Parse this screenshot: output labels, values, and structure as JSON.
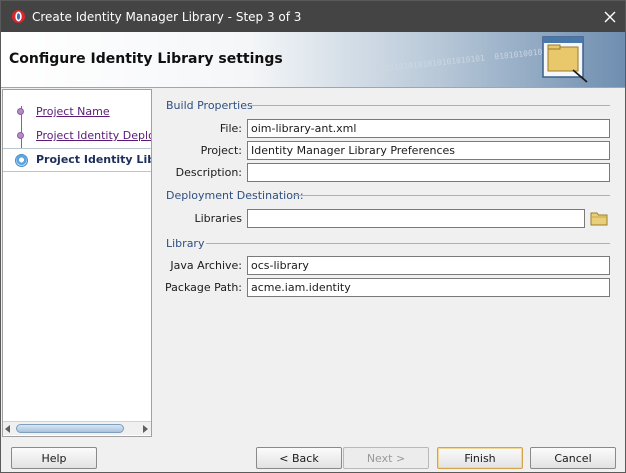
{
  "window": {
    "title": "Create Identity Manager Library - Step 3 of 3"
  },
  "header": {
    "title": "Configure Identity Library settings",
    "binary_watermark": "0101010101010101010101  0101010010"
  },
  "nav": {
    "items": [
      {
        "label": "Project Name",
        "state": "visited"
      },
      {
        "label": "Project Identity Deployment",
        "state": "visited"
      },
      {
        "label": "Project Identity Library",
        "state": "current"
      }
    ]
  },
  "form": {
    "build_properties": {
      "section_label": "Build Properties",
      "file_label": "File:",
      "file_value": "oim-library-ant.xml",
      "project_label": "Project:",
      "project_value": "Identity Manager Library Preferences",
      "description_label": "Description:",
      "description_value": ""
    },
    "deployment_destination": {
      "section_label": "Deployment Destination:",
      "libraries_label": "Libraries",
      "libraries_value": ""
    },
    "library": {
      "section_label": "Library",
      "java_archive_label": "Java Archive:",
      "java_archive_value": "ocs-library",
      "package_path_label": "Package Path:",
      "package_path_value": "acme.iam.identity"
    }
  },
  "buttons": {
    "help": "Help",
    "back": "< Back",
    "next": "Next >",
    "finish": "Finish",
    "cancel": "Cancel"
  },
  "colors": {
    "title_bar": "#444444",
    "section_label": "#2e4f80",
    "nav_link": "#5b1a78",
    "default_button_border": "#d4a44c"
  },
  "icons": {
    "app": "oracle-app-icon",
    "close": "close-icon",
    "header_graphic": "folder-window-graphic",
    "libraries_browse": "folder-icon"
  }
}
